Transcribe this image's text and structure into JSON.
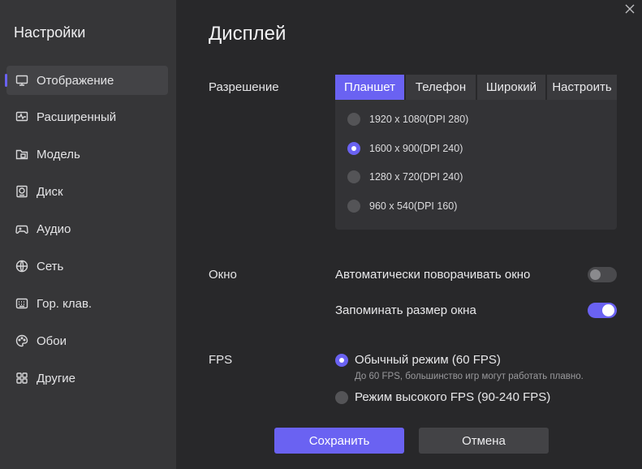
{
  "sidebar": {
    "title": "Настройки",
    "items": [
      {
        "label": "Отображение",
        "icon": "monitor-icon",
        "active": true
      },
      {
        "label": "Расширенный",
        "icon": "pulse-icon"
      },
      {
        "label": "Модель",
        "icon": "folder-icon"
      },
      {
        "label": "Диск",
        "icon": "disk-icon"
      },
      {
        "label": "Аудио",
        "icon": "gamepad-icon"
      },
      {
        "label": "Сеть",
        "icon": "globe-icon"
      },
      {
        "label": "Гор. клав.",
        "icon": "keyboard-icon"
      },
      {
        "label": "Обои",
        "icon": "palette-icon"
      },
      {
        "label": "Другие",
        "icon": "grid-icon"
      }
    ]
  },
  "main": {
    "title": "Дисплей",
    "resolution": {
      "label": "Разрешение",
      "tabs": [
        "Планшет",
        "Телефон",
        "Широкий",
        "Настроить"
      ],
      "active_tab": "Планшет",
      "options": [
        "1920 x 1080(DPI 280)",
        "1600 x 900(DPI 240)",
        "1280 x 720(DPI 240)",
        "960 x 540(DPI 160)"
      ],
      "selected": "1600 x 900(DPI 240)"
    },
    "window": {
      "label": "Окно",
      "auto_rotate": {
        "label": "Автоматически поворачивать окно",
        "on": false
      },
      "remember_size": {
        "label": "Запоминать размер окна",
        "on": true
      }
    },
    "fps": {
      "label": "FPS",
      "normal": {
        "label": "Обычный режим (60 FPS)",
        "hint": "До 60 FPS, большинство игр могут работать плавно.",
        "selected": true
      },
      "high": {
        "label": "Режим высокого FPS (90-240 FPS)",
        "selected": false
      }
    }
  },
  "footer": {
    "save_label": "Сохранить",
    "cancel_label": "Отмена"
  },
  "colors": {
    "accent": "#6a62f2",
    "sidebar_bg": "#363638",
    "main_bg": "#28282a"
  }
}
